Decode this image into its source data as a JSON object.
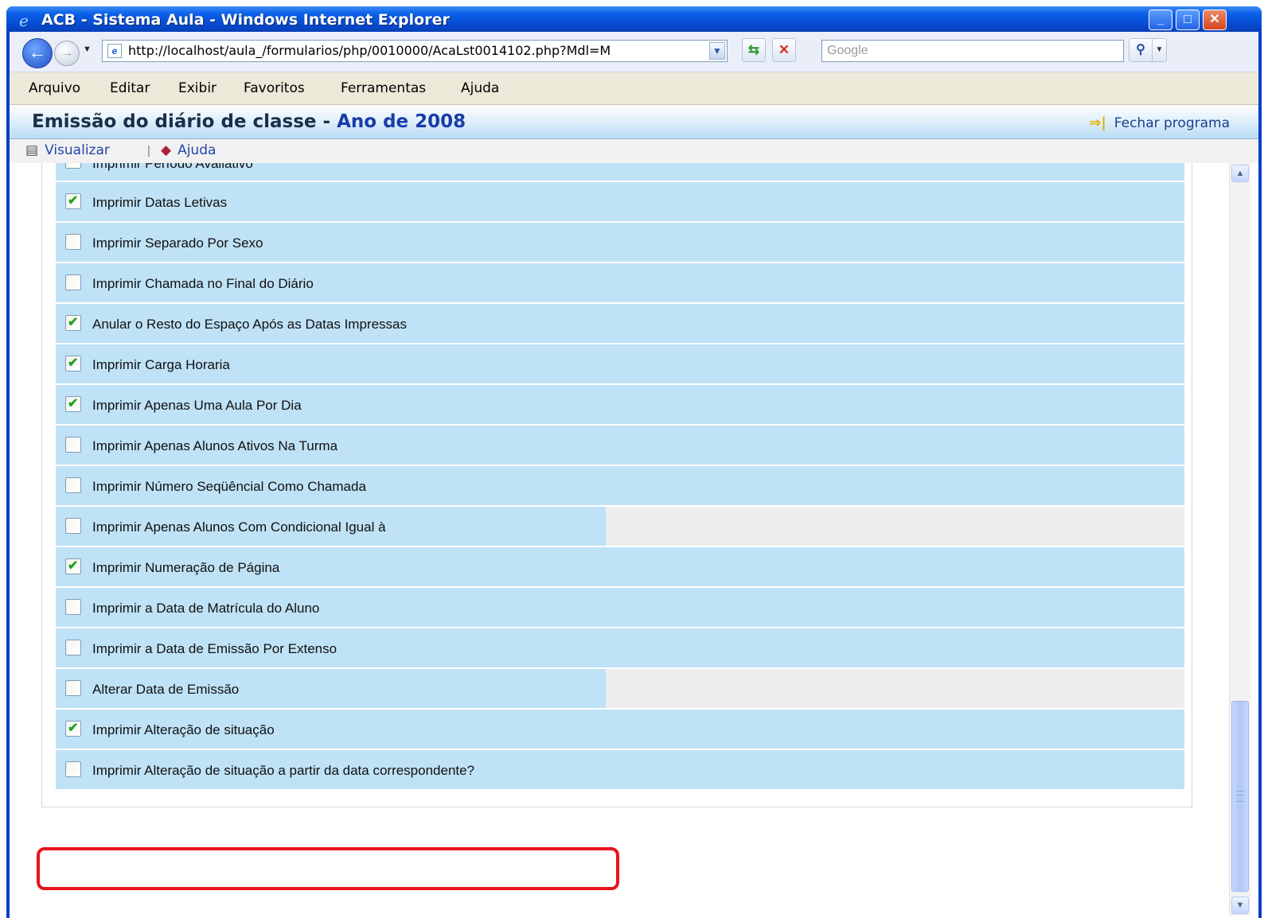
{
  "window": {
    "title": "ACB - Sistema Aula - Windows Internet Explorer",
    "minimize_label": "_",
    "maximize_label": "□",
    "close_label": "✕"
  },
  "navbar": {
    "url": "http://localhost/aula_/formularios/php/0010000/AcaLst0014102.php?Mdl=M",
    "search_placeholder": "Google"
  },
  "menu": {
    "items": [
      "Arquivo",
      "Editar",
      "Exibir",
      "Favoritos",
      "Ferramentas",
      "Ajuda"
    ]
  },
  "app": {
    "title": "Emissão do diário de classe",
    "title_separator": " - ",
    "year_label": "Ano de 2008",
    "close_program_label": "Fechar programa"
  },
  "toolbar": {
    "view_label": "Visualizar",
    "separator": "|",
    "help_label": "Ajuda"
  },
  "options": [
    {
      "label": "Imprimir Período Avaliativo",
      "checked": true
    },
    {
      "label": "Imprimir Datas Letivas",
      "checked": true
    },
    {
      "label": "Imprimir Separado Por Sexo",
      "checked": false
    },
    {
      "label": "Imprimir Chamada no Final do Diário",
      "checked": false
    },
    {
      "label": "Anular o Resto do Espaço Após as Datas Impressas",
      "checked": true
    },
    {
      "label": "Imprimir Carga Horaria",
      "checked": true
    },
    {
      "label": "Imprimir Apenas Uma Aula Por Dia",
      "checked": true
    },
    {
      "label": "Imprimir Apenas Alunos Ativos Na Turma",
      "checked": false
    },
    {
      "label": "Imprimir Número Seqüêncial Como Chamada",
      "checked": false
    },
    {
      "label": "Imprimir Apenas Alunos Com Condicional Igual à",
      "checked": false
    },
    {
      "label": "Imprimir Numeração de Página",
      "checked": true
    },
    {
      "label": "Imprimir a Data de Matrícula do Aluno",
      "checked": false
    },
    {
      "label": "Imprimir a Data de Emissão Por Extenso",
      "checked": false
    },
    {
      "label": "Alterar Data de Emissão",
      "checked": false
    },
    {
      "label": "Imprimir Alteração de situação",
      "checked": true
    },
    {
      "label": "Imprimir Alteração de situação a partir da data correspondente?",
      "checked": false
    }
  ],
  "colors": {
    "row_background": "#bfe2f6",
    "highlight_border": "#e8131d",
    "check_color": "#23a21d"
  }
}
